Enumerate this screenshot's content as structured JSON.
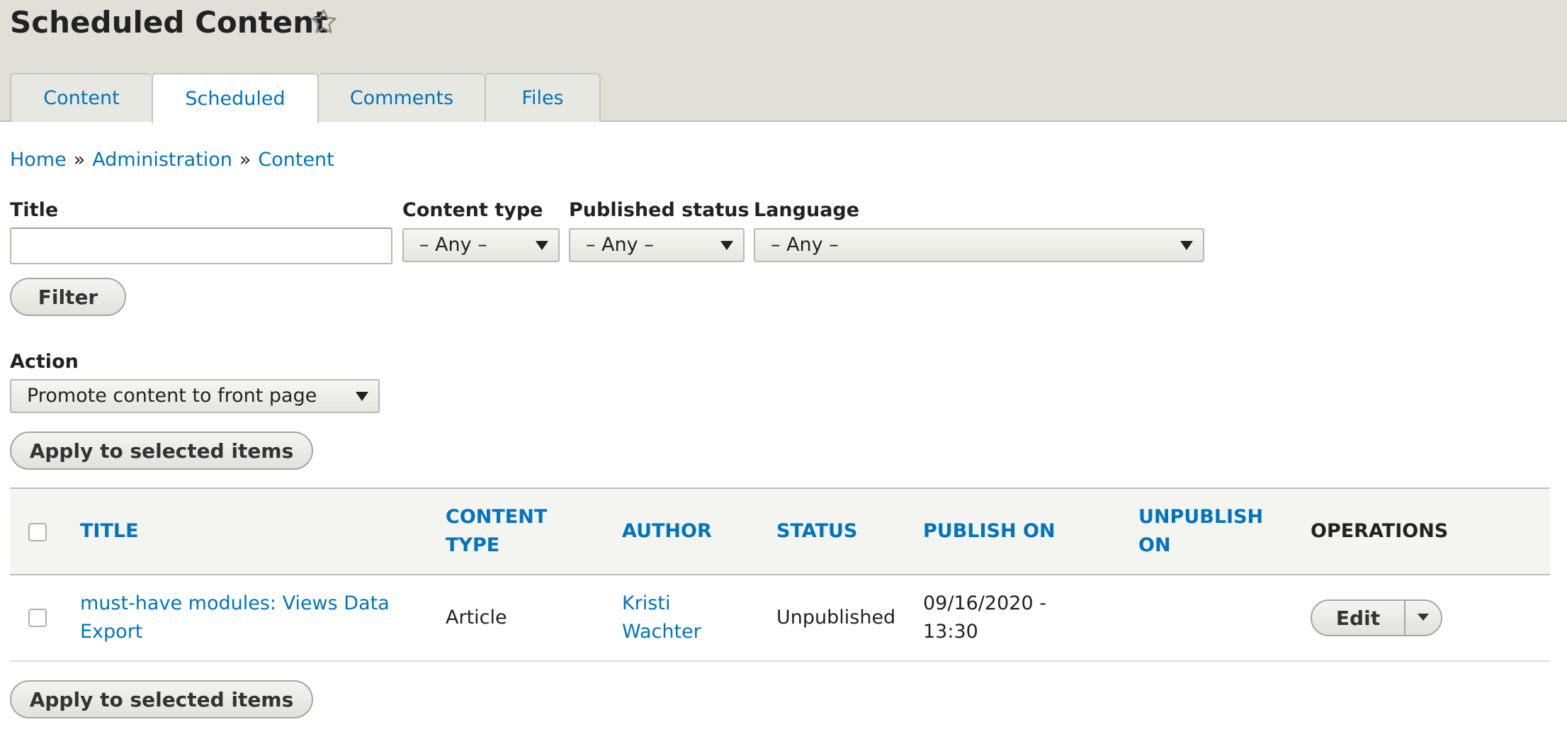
{
  "page": {
    "title": "Scheduled Content"
  },
  "tabs": [
    {
      "label": "Content"
    },
    {
      "label": "Scheduled"
    },
    {
      "label": "Comments"
    },
    {
      "label": "Files"
    }
  ],
  "breadcrumb": {
    "items": [
      "Home",
      "Administration",
      "Content"
    ],
    "separator": "»"
  },
  "filters": {
    "title_label": "Title",
    "title_value": "",
    "content_type_label": "Content type",
    "content_type_value": "– Any –",
    "published_status_label": "Published status",
    "published_status_value": "– Any –",
    "language_label": "Language",
    "language_value": "– Any –",
    "filter_button": "Filter"
  },
  "action": {
    "label": "Action",
    "value": "Promote content to front page",
    "apply_button": "Apply to selected items"
  },
  "table": {
    "headers": {
      "title": "TITLE",
      "content_type": "CONTENT TYPE",
      "author": "AUTHOR",
      "status": "STATUS",
      "publish_on": "PUBLISH ON",
      "unpublish_on": "UNPUBLISH ON",
      "operations": "OPERATIONS"
    },
    "rows": [
      {
        "title": "must-have modules: Views Data Export",
        "content_type": "Article",
        "author": "Kristi Wachter",
        "status": "Unpublished",
        "publish_on": "09/16/2020 - 13:30",
        "unpublish_on": "",
        "operation": "Edit"
      }
    ]
  },
  "bottom_apply_button": "Apply to selected items",
  "colors": {
    "link": "#0074bd",
    "header_bg": "#e0e0d8"
  },
  "icons": {
    "favorite": "star-outline-icon",
    "dropdown": "chevron-down-icon"
  }
}
